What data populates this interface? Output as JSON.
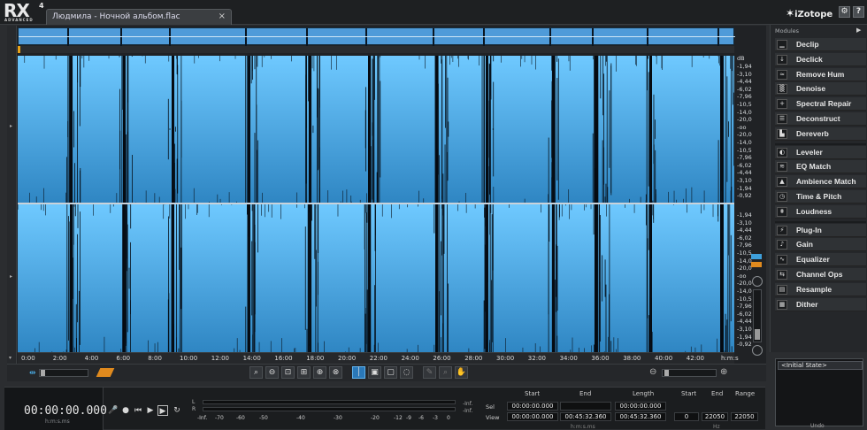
{
  "app": {
    "logo": "RX",
    "logo_version": "4",
    "logo_edition": "ADVANCED",
    "brand": "iZotope"
  },
  "tab": {
    "title": "Людмила - Ночной альбом.flac",
    "close": "×"
  },
  "top_buttons": {
    "settings": "⚙",
    "help": "?"
  },
  "db_scale": {
    "unit": "dB",
    "top": [
      "-1,94",
      "-3,10",
      "-4,44",
      "-6,02",
      "-7,96",
      "-10,5",
      "-14,0",
      "-20,0",
      "-oo",
      "-20,0",
      "-14,0",
      "-10,5",
      "-7,96",
      "-6,02",
      "-4,44",
      "-3,10",
      "-1,94",
      "-0,92"
    ],
    "bottom": [
      "-1,94",
      "-3,10",
      "-4,44",
      "-6,02",
      "-7,96",
      "-10,5",
      "-14,0",
      "-20,0",
      "-oo",
      "-20,0",
      "-14,0",
      "-10,5",
      "-7,96",
      "-6,02",
      "-4,44",
      "-3,10",
      "-1,94",
      "-0,92"
    ]
  },
  "timeline": {
    "ticks": [
      "0:00",
      "2:00",
      "4:00",
      "6:00",
      "8:00",
      "10:00",
      "12:00",
      "14:00",
      "16:00",
      "18:00",
      "20:00",
      "22:00",
      "24:00",
      "26:00",
      "28:00",
      "30:00",
      "32:00",
      "34:00",
      "36:00",
      "38:00",
      "40:00",
      "42:00"
    ],
    "unit": "h:m:s"
  },
  "toolbar": {
    "tools": [
      "⌕",
      "⊖",
      "⊡",
      "⊞",
      "⊕",
      "⊗",
      "│",
      "▣",
      "▢",
      "◌",
      "✎",
      "⌕",
      "✋"
    ],
    "active_index": 6
  },
  "transport": {
    "time": "00:00:00.000",
    "time_unit": "h:m:s.ms",
    "buttons": [
      "🎤",
      "●",
      "⏮",
      "▶",
      "▶",
      "↻"
    ],
    "meter_L": "L",
    "meter_R": "R",
    "meter_scale": [
      "-Inf.",
      "-70",
      "-60",
      "-50",
      "-40",
      "-30",
      "-20",
      "-12",
      "-9",
      "-6",
      "-3",
      "0"
    ],
    "inf_top": "-Inf.",
    "inf_bottom": "-Inf."
  },
  "selection": {
    "headers": [
      "Start",
      "End",
      "Length"
    ],
    "rows": [
      {
        "label": "Sel",
        "values": [
          "00:00:00.000",
          "",
          "00:00:00.000"
        ]
      },
      {
        "label": "View",
        "values": [
          "00:00:00.000",
          "00:45:32.360",
          "00:45:32.360"
        ]
      }
    ],
    "units": "h:m:s.ms",
    "freq_headers": [
      "Start",
      "End",
      "Range"
    ],
    "freq_values": [
      "0",
      "22050",
      "22050"
    ],
    "freq_units": "Hz"
  },
  "modules": {
    "header": "Modules",
    "items": [
      {
        "label": "Declip",
        "icon": "▁"
      },
      {
        "label": "Declick",
        "icon": "↓"
      },
      {
        "label": "Remove Hum",
        "icon": "≈"
      },
      {
        "label": "Denoise",
        "icon": "▒"
      },
      {
        "label": "Spectral Repair",
        "icon": "+"
      },
      {
        "label": "Deconstruct",
        "icon": "☰"
      },
      {
        "label": "Dereverb",
        "icon": "▙"
      },
      {
        "label": "Leveler",
        "icon": "◐"
      },
      {
        "label": "EQ Match",
        "icon": "≋"
      },
      {
        "label": "Ambience Match",
        "icon": "▲"
      },
      {
        "label": "Time & Pitch",
        "icon": "◷"
      },
      {
        "label": "Loudness",
        "icon": "⩩"
      },
      {
        "label": "Plug-In",
        "icon": "⚡"
      },
      {
        "label": "Gain",
        "icon": "♪"
      },
      {
        "label": "Equalizer",
        "icon": "∿"
      },
      {
        "label": "Channel Ops",
        "icon": "⇆"
      },
      {
        "label": "Resample",
        "icon": "▤"
      },
      {
        "label": "Dither",
        "icon": "▦"
      }
    ]
  },
  "history": {
    "items": [
      "<Initial State>"
    ],
    "footer": "Undo"
  }
}
